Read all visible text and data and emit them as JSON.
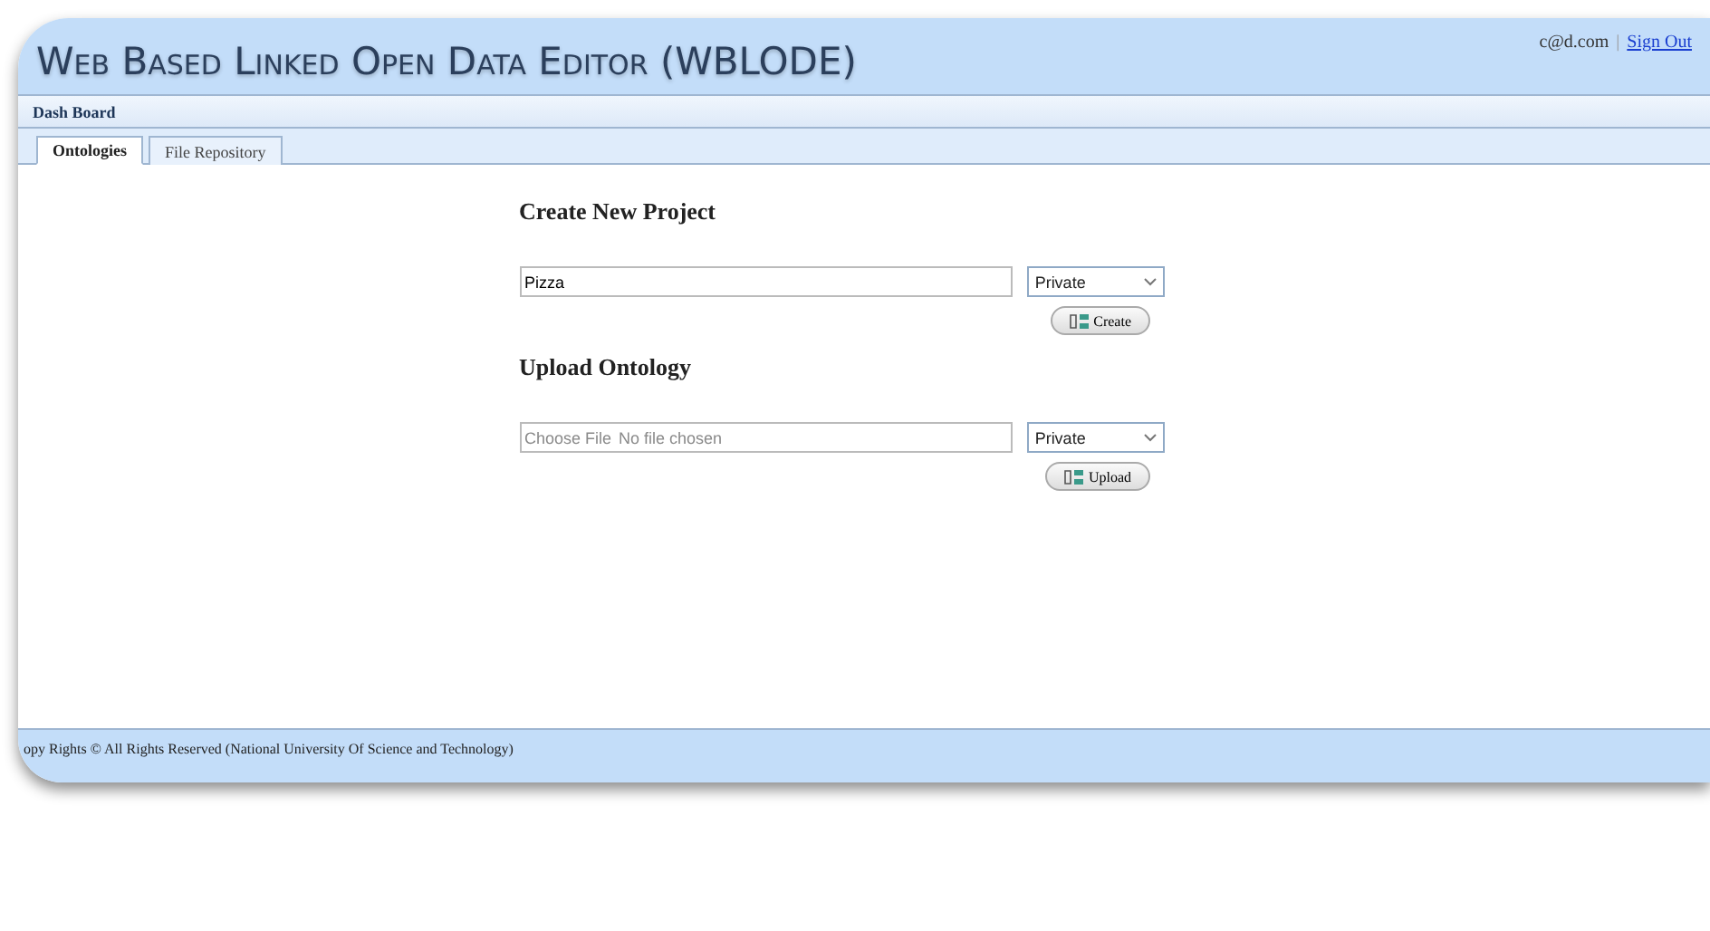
{
  "header": {
    "title": "Web Based Linked Open Data Editor (WBLODE)",
    "user": "c@d.com",
    "separator": "|",
    "sign_out": "Sign Out"
  },
  "nav": {
    "label": "Dash Board"
  },
  "tabs": [
    {
      "label": "Ontologies",
      "selected": true
    },
    {
      "label": "File Repository",
      "selected": false
    }
  ],
  "create_project": {
    "heading": "Create New Project",
    "name_value": "Pizza",
    "visibility": "Private",
    "button": "Create"
  },
  "upload_ontology": {
    "heading": "Upload Ontology",
    "file_button": "Choose File",
    "file_status": "No file chosen",
    "visibility": "Private",
    "button": "Upload"
  },
  "footer": {
    "text": "opy Rights © All Rights Reserved (National University Of Science and Technology)"
  }
}
